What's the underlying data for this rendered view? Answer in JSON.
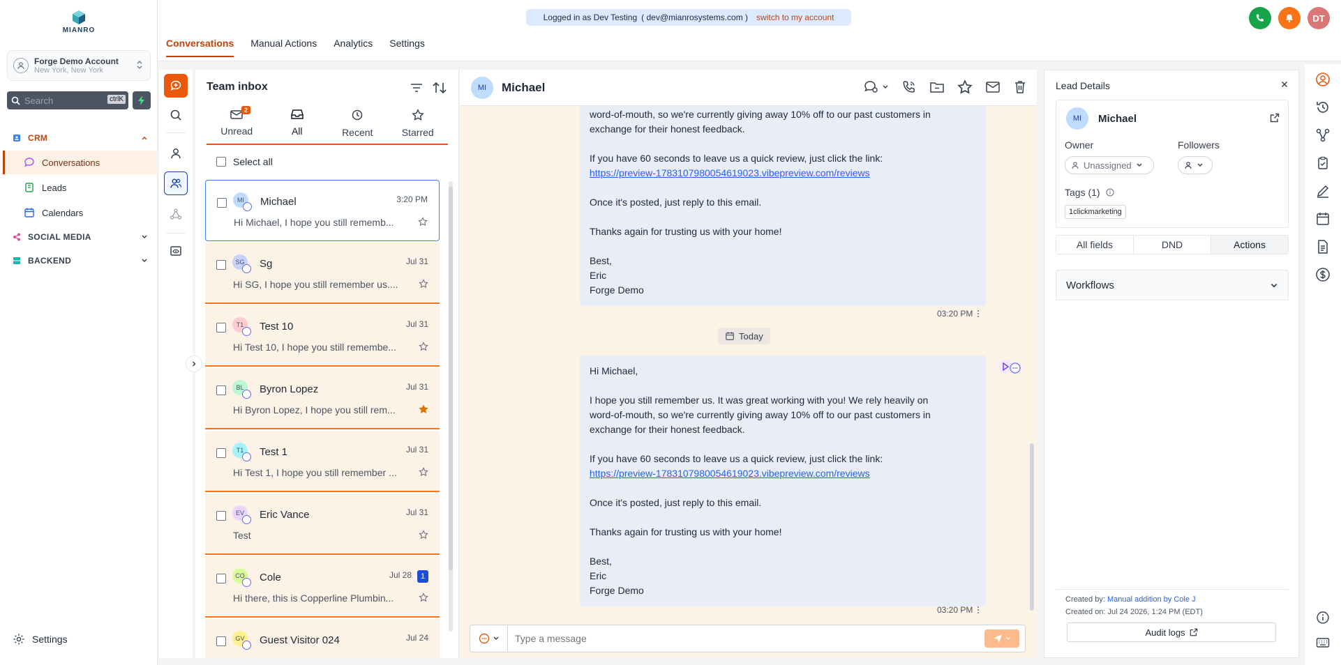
{
  "brand": {
    "logo_text": "MIANRO"
  },
  "account": {
    "name": "Forge Demo Account",
    "location": "New York, New York"
  },
  "search": {
    "placeholder": "Search",
    "shortcut": "ctrlK"
  },
  "sidebar": {
    "sections": [
      {
        "label": "CRM",
        "color": "#c2410c"
      },
      {
        "label": "SOCIAL MEDIA",
        "color": "#374151"
      },
      {
        "label": "BACKEND",
        "color": "#374151"
      }
    ],
    "crm_items": [
      {
        "label": "Conversations",
        "active": true
      },
      {
        "label": "Leads",
        "active": false
      },
      {
        "label": "Calendars",
        "active": false
      }
    ],
    "settings_label": "Settings"
  },
  "banner": {
    "text": "Logged in as Dev Testing",
    "email": "( dev@mianrosystems.com )",
    "switch_label": "switch to my account"
  },
  "top_tabs": [
    "Conversations",
    "Manual Actions",
    "Analytics",
    "Settings"
  ],
  "user_initials": "DT",
  "colors": {
    "accent": "#ea580c",
    "call": "#16a34a",
    "notify": "#f97316",
    "user": "#d97777"
  },
  "inbox": {
    "title": "Team inbox",
    "tabs": [
      {
        "label": "Unread",
        "badge": "2",
        "icon": "inbox-icon"
      },
      {
        "label": "All",
        "icon": "tray-icon"
      },
      {
        "label": "Recent",
        "icon": "clock-icon"
      },
      {
        "label": "Starred",
        "icon": "star-icon"
      }
    ],
    "select_all": "Select all",
    "conversations": [
      {
        "initials": "MI",
        "name": "Michael",
        "time": "3:20 PM",
        "preview": "Hi Michael, I hope you still rememb...",
        "starred": false,
        "avatar_color": "#bfdbfe",
        "selected": true
      },
      {
        "initials": "SG",
        "name": "Sg",
        "time": "Jul 31",
        "preview": "Hi SG, I hope you still remember us....",
        "starred": false,
        "avatar_color": "#c7d2fe"
      },
      {
        "initials": "T1",
        "name": "Test 10",
        "time": "Jul 31",
        "preview": "Hi Test 10, I hope you still remembe...",
        "starred": false,
        "avatar_color": "#fecdd3"
      },
      {
        "initials": "BL",
        "name": "Byron Lopez",
        "time": "Jul 31",
        "preview": "Hi Byron Lopez, I hope you still rem...",
        "starred": true,
        "avatar_color": "#bbf7d0"
      },
      {
        "initials": "T1",
        "name": "Test 1",
        "time": "Jul 31",
        "preview": "Hi Test 1, I hope you still remember ...",
        "starred": false,
        "avatar_color": "#a5f3fc"
      },
      {
        "initials": "EV",
        "name": "Eric Vance",
        "time": "Jul 31",
        "preview": "Test",
        "starred": false,
        "avatar_color": "#e9d5ff"
      },
      {
        "initials": "CO",
        "name": "Cole",
        "time": "Jul 28",
        "preview": "Hi there, this is Copperline Plumbin...",
        "starred": false,
        "avatar_color": "#d9f99d",
        "unread": "1"
      },
      {
        "initials": "GV",
        "name": "Guest Visitor 024",
        "time": "Jul 24",
        "preview": "",
        "starred": false,
        "avatar_color": "#fef08a"
      }
    ]
  },
  "chat": {
    "contact_initials": "MI",
    "contact_name": "Michael",
    "message1": {
      "line_a": "word-of-mouth, so we're currently giving away 10% off to our past customers in",
      "line_b": "exchange for their honest feedback.",
      "review_text": "If you have 60 seconds to leave us a quick review, just click the link:",
      "link": "https://preview-1783107980054619023.vibepreview.com/reviews",
      "posted": "Once it's posted, just reply to this email.",
      "thanks": "Thanks again for trusting us with your home!",
      "signoff": "Best,",
      "sig_name": "Eric",
      "sig_company": "Forge Demo",
      "time": "03:20 PM"
    },
    "date_divider": "Today",
    "message2": {
      "greeting": "Hi Michael,",
      "body_a": "I hope you still remember us. It was great working with you! We rely heavily on",
      "body_b": "word-of-mouth, so we're currently giving away 10% off to our past customers in",
      "body_c": "exchange for their honest feedback.",
      "review_text": "If you have 60 seconds to leave us a quick review, just click the link:",
      "link": "https://preview-1783107980054619023.vibepreview.com/reviews",
      "posted": "Once it's posted, just reply to this email.",
      "thanks": "Thanks again for trusting us with your home!",
      "signoff": "Best,",
      "sig_name": "Eric",
      "sig_company": "Forge Demo",
      "time": "03:20 PM"
    },
    "composer_placeholder": "Type a message"
  },
  "lead": {
    "title": "Lead Details",
    "initials": "MI",
    "name": "Michael",
    "owner_label": "Owner",
    "owner_value": "Unassigned",
    "followers_label": "Followers",
    "tags_label": "Tags (1)",
    "tag": "1clickmarketing",
    "tabs": [
      "All fields",
      "DND",
      "Actions"
    ],
    "workflows_label": "Workflows",
    "created_by_label": "Created by:",
    "created_by_value": "Manual addition by Cole J",
    "created_on": "Created on: Jul 24 2026, 1:24 PM (EDT)",
    "audit_label": "Audit logs"
  }
}
